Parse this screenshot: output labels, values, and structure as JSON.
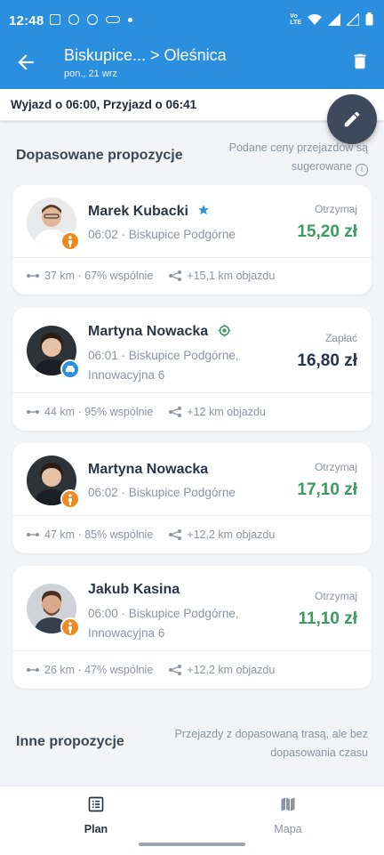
{
  "status": {
    "time": "12:48"
  },
  "header": {
    "title": "Biskupice... > Oleśnica",
    "subtitle": "pon., 21 wrz"
  },
  "trip_info": "Wyjazd o 06:00, Przyjazd o 06:41",
  "matched": {
    "title": "Dopasowane propozycje",
    "note": "Podane ceny przejazdów są sugerowane"
  },
  "cards": [
    {
      "name": "Marek Kubacki",
      "meta": "06:02 · Biskupice Podgórne",
      "price_label": "Otrzymaj",
      "price": "15,20 zł",
      "distance": "37 km · 67% wspólnie",
      "detour": "+15,1 km objazdu"
    },
    {
      "name": "Martyna Nowacka",
      "meta": "06:01 · Biskupice Podgórne, Innowacyjna 6",
      "price_label": "Zapłać",
      "price": "16,80 zł",
      "distance": "44 km · 95% wspólnie",
      "detour": "+12 km objazdu"
    },
    {
      "name": "Martyna Nowacka",
      "meta": "06:02 · Biskupice Podgórne",
      "price_label": "Otrzymaj",
      "price": "17,10 zł",
      "distance": "47 km · 85% wspólnie",
      "detour": "+12,2 km objazdu"
    },
    {
      "name": "Jakub Kasina",
      "meta": "06:00 · Biskupice Podgórne, Innowacyjna 6",
      "price_label": "Otrzymaj",
      "price": "11,10 zł",
      "distance": "26 km · 47% wspólnie",
      "detour": "+12,2 km objazdu"
    }
  ],
  "other": {
    "title": "Inne propozycje",
    "note": "Przejazdy z dopasowaną trasą, ale bez dopasowania czasu"
  },
  "nav": {
    "plan": "Plan",
    "map": "Mapa"
  },
  "colors": {
    "primary": "#2b8fe0",
    "price_green": "#3a9b5f",
    "fab": "#3d4a5c",
    "badge_orange": "#ef8a1f"
  }
}
